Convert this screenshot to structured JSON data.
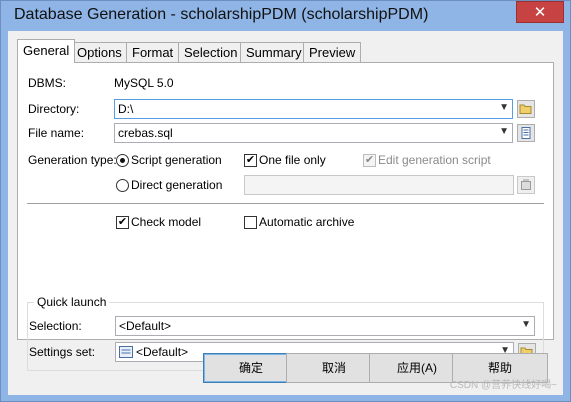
{
  "window": {
    "title": "Database Generation - scholarshipPDM (scholarshipPDM)",
    "close_glyph": "✕"
  },
  "tabs": [
    "General",
    "Options",
    "Format",
    "Selection",
    "Summary",
    "Preview"
  ],
  "general": {
    "dbms_label": "DBMS:",
    "dbms_value": "MySQL 5.0",
    "directory_label": "Directory:",
    "directory_value": "D:\\",
    "filename_label": "File name:",
    "filename_value": "crebas.sql",
    "gentype_label": "Generation type:",
    "script_generation": "Script generation",
    "direct_generation": "Direct generation",
    "one_file_only": "One file only",
    "edit_generation_script": "Edit generation script",
    "check_model": "Check model",
    "automatic_archive": "Automatic archive"
  },
  "quick_launch": {
    "title": "Quick launch",
    "selection_label": "Selection:",
    "selection_value": "<Default>",
    "settings_label": "Settings set:",
    "settings_value": "<Default>"
  },
  "buttons": {
    "ok": "确定",
    "cancel": "取消",
    "apply": "应用(A)",
    "help": "帮助"
  },
  "watermark": "CSDN @营养快线好喝~",
  "icons": {
    "dropdown": "chevron-down-icon",
    "folder": "folder-icon",
    "properties": "properties-icon"
  },
  "colors": {
    "titlebar": "#8fb4e6",
    "close": "#c74343",
    "focus_border": "#569de5"
  }
}
